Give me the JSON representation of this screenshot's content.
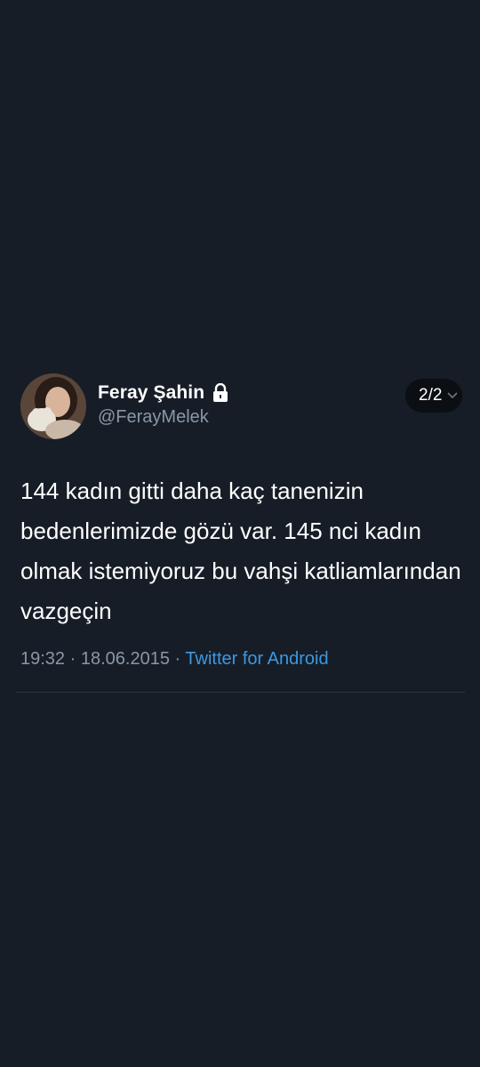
{
  "tweet": {
    "display_name": "Feray Şahin",
    "handle": "@FerayMelek",
    "page_indicator": "2/2",
    "text": "144 kadın gitti daha kaç tanenizin bedenlerimizde gözü var. 145 nci kadın olmak istemiyoruz bu vahşi katliamlarından vazgeçin",
    "time": "19:32",
    "separator": "·",
    "date": "18.06.2015",
    "source": "Twitter for Android",
    "icons": {
      "avatar": "profile-photo",
      "lock": "lock-icon",
      "chevron": "chevron-down-icon"
    },
    "colors": {
      "background": "#161d27",
      "source_link": "#3d98e0",
      "muted_text": "#8a97a5"
    }
  }
}
